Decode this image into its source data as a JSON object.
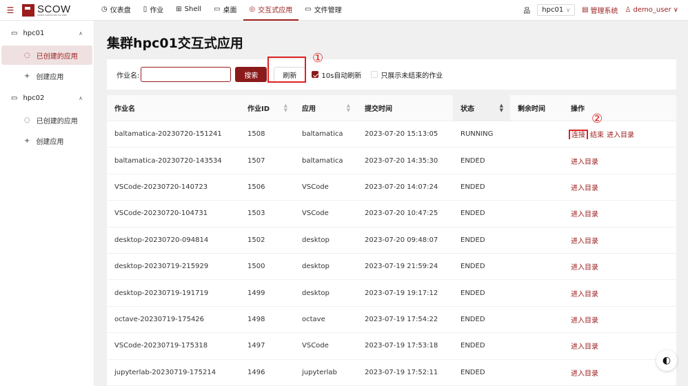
{
  "header": {
    "logo_text": "SCOW",
    "logo_sub": "SUPER COMPUTING ON WEB",
    "nav": [
      {
        "label": "仪表盘",
        "icon": "◷"
      },
      {
        "label": "作业",
        "icon": "▯"
      },
      {
        "label": "Shell",
        "icon": "⊞"
      },
      {
        "label": "桌面",
        "icon": "▭"
      },
      {
        "label": "交互式应用",
        "icon": "◎"
      },
      {
        "label": "文件管理",
        "icon": "▭"
      }
    ],
    "cluster_value": "hpc01",
    "admin_label": "管理系统",
    "user_label": "demo_user"
  },
  "sidebar": {
    "groups": [
      {
        "label": "hpc01",
        "items": [
          {
            "label": "已创建的应用"
          },
          {
            "label": "创建应用"
          }
        ]
      },
      {
        "label": "hpc02",
        "items": [
          {
            "label": "已创建的应用"
          },
          {
            "label": "创建应用"
          }
        ]
      }
    ]
  },
  "page": {
    "title": "集群hpc01交互式应用",
    "filter": {
      "name_label": "作业名:",
      "name_value": "",
      "search_label": "搜索",
      "refresh_label": "刷新",
      "auto_refresh_label": "10s自动刷新",
      "auto_refresh_checked": true,
      "only_unfinished_label": "只展示未结束的作业",
      "only_unfinished_checked": false
    },
    "annotations": [
      "①",
      "②"
    ]
  },
  "table": {
    "columns": [
      "作业名",
      "作业ID",
      "应用",
      "提交时间",
      "状态",
      "剩余时间",
      "操作"
    ],
    "rows": [
      {
        "name": "baltamatica-20230720-151241",
        "id": "1508",
        "app": "baltamatica",
        "time": "2023-07-20 15:13:05",
        "status": "RUNNING",
        "remaining": "",
        "ops": [
          "连接",
          "结束",
          "进入目录"
        ]
      },
      {
        "name": "baltamatica-20230720-143534",
        "id": "1507",
        "app": "baltamatica",
        "time": "2023-07-20 14:35:30",
        "status": "ENDED",
        "remaining": "",
        "ops": [
          "进入目录"
        ]
      },
      {
        "name": "VSCode-20230720-140723",
        "id": "1506",
        "app": "VSCode",
        "time": "2023-07-20 14:07:24",
        "status": "ENDED",
        "remaining": "",
        "ops": [
          "进入目录"
        ]
      },
      {
        "name": "VSCode-20230720-104731",
        "id": "1503",
        "app": "VSCode",
        "time": "2023-07-20 10:47:25",
        "status": "ENDED",
        "remaining": "",
        "ops": [
          "进入目录"
        ]
      },
      {
        "name": "desktop-20230720-094814",
        "id": "1502",
        "app": "desktop",
        "time": "2023-07-20 09:48:07",
        "status": "ENDED",
        "remaining": "",
        "ops": [
          "进入目录"
        ]
      },
      {
        "name": "desktop-20230719-215929",
        "id": "1500",
        "app": "desktop",
        "time": "2023-07-19 21:59:24",
        "status": "ENDED",
        "remaining": "",
        "ops": [
          "进入目录"
        ]
      },
      {
        "name": "desktop-20230719-191719",
        "id": "1499",
        "app": "desktop",
        "time": "2023-07-19 19:17:12",
        "status": "ENDED",
        "remaining": "",
        "ops": [
          "进入目录"
        ]
      },
      {
        "name": "octave-20230719-175426",
        "id": "1498",
        "app": "octave",
        "time": "2023-07-19 17:54:22",
        "status": "ENDED",
        "remaining": "",
        "ops": [
          "进入目录"
        ]
      },
      {
        "name": "VSCode-20230719-175318",
        "id": "1497",
        "app": "VSCode",
        "time": "2023-07-19 17:53:18",
        "status": "ENDED",
        "remaining": "",
        "ops": [
          "进入目录"
        ]
      },
      {
        "name": "jupyterlab-20230719-175214",
        "id": "1496",
        "app": "jupyterlab",
        "time": "2023-07-19 17:52:11",
        "status": "ENDED",
        "remaining": "",
        "ops": [
          "进入目录"
        ]
      }
    ]
  },
  "colors": {
    "accent": "#9b1c1c",
    "annotation": "#e02020"
  }
}
